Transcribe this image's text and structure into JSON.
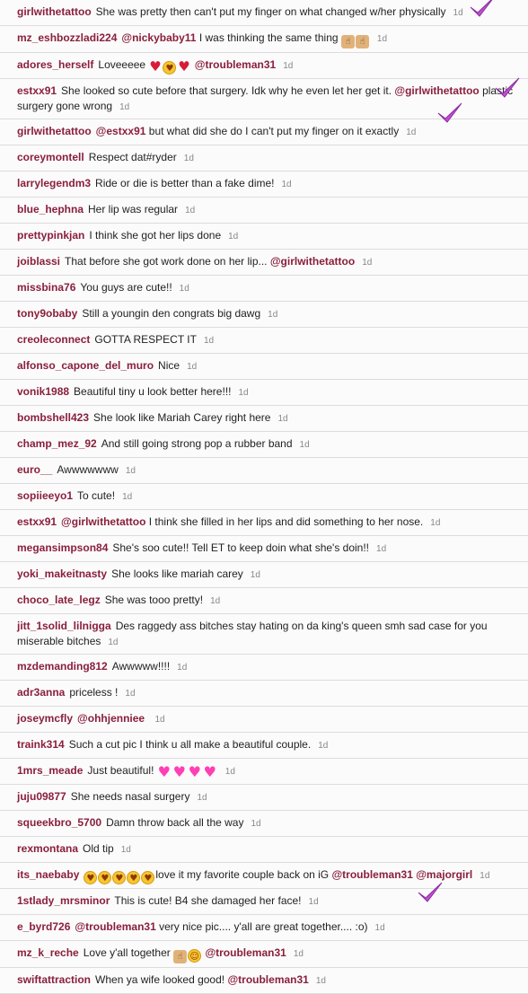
{
  "comments": [
    {
      "user": "girlwithetattoo",
      "text": "She was pretty then can't put my finger on what changed w/her physically",
      "time": "1d"
    },
    {
      "user": "mz_eshbozzladi224",
      "mention": "@nickybaby11",
      "text": "I was thinking the same thing",
      "emoji_after": [
        "thumbs-up",
        "thumbs-up"
      ],
      "time": "1d"
    },
    {
      "user": "adores_herself",
      "text": "Loveeeee",
      "emoji_after": [
        "heart",
        "heart-eyes",
        "heart"
      ],
      "mention_after": "@troubleman31",
      "time": "1d"
    },
    {
      "user": "estxx91",
      "text": "She looked so cute before that surgery. Idk why he even let her get it.",
      "mention_after": "@girlwithetattoo",
      "text_after": "plastic surgery gone wrong",
      "time": "1d"
    },
    {
      "user": "girlwithetattoo",
      "mention": "@estxx91",
      "text": "but what did she do I can't put my finger on it exactly",
      "time": "1d"
    },
    {
      "user": "coreymontell",
      "text": "Respect dat#ryder",
      "time": "1d"
    },
    {
      "user": "larrylegendm3",
      "text": "Ride or die is better than a fake dime!",
      "time": "1d"
    },
    {
      "user": "blue_hephna",
      "text": "Her lip was regular",
      "time": "1d"
    },
    {
      "user": "prettypinkjan",
      "text": "I think she got her lips done",
      "time": "1d"
    },
    {
      "user": "joiblassi",
      "text": "That before she got work done on her lip...",
      "mention_after": "@girlwithetattoo",
      "time": "1d"
    },
    {
      "user": "missbina76",
      "text": "You guys are cute!!",
      "time": "1d"
    },
    {
      "user": "tony9obaby",
      "text": "Still a youngin den congrats big dawg",
      "time": "1d"
    },
    {
      "user": "creoleconnect",
      "text": "GOTTA RESPECT IT",
      "time": "1d"
    },
    {
      "user": "alfonso_capone_del_muro",
      "text": "Nice",
      "time": "1d"
    },
    {
      "user": "vonik1988",
      "text": "Beautiful tiny u look better here!!!",
      "time": "1d"
    },
    {
      "user": "bombshell423",
      "text": "She look like Mariah Carey right here",
      "time": "1d"
    },
    {
      "user": "champ_mez_92",
      "text": "And still going strong pop a rubber band",
      "time": "1d"
    },
    {
      "user": "euro__",
      "text": "Awwwwwww",
      "time": "1d"
    },
    {
      "user": "sopiieeyo1",
      "text": "To cute!",
      "time": "1d"
    },
    {
      "user": "estxx91",
      "mention": "@girlwithetattoo",
      "text": "I think she filled in her lips and did something to her nose.",
      "time": "1d"
    },
    {
      "user": "megansimpson84",
      "text": "She's soo cute!! Tell ET to keep doin what she's doin!!",
      "time": "1d"
    },
    {
      "user": "yoki_makeitnasty",
      "text": "She looks like mariah carey",
      "time": "1d"
    },
    {
      "user": "choco_late_legz",
      "text": "She was tooo pretty!",
      "time": "1d"
    },
    {
      "user": "jitt_1solid_lilnigga",
      "text": "Des raggedy ass bitches stay hating on da king's queen smh sad case for you miserable bitches",
      "time": "1d"
    },
    {
      "user": "mzdemanding812",
      "text": "Awwwww!!!!",
      "time": "1d"
    },
    {
      "user": "adr3anna",
      "text": "priceless !",
      "time": "1d"
    },
    {
      "user": "joseymcfly",
      "mention": "@ohhjenniee",
      "text": "",
      "time": "1d"
    },
    {
      "user": "traink314",
      "text": "Such a cut pic I think u all make a beautiful couple.",
      "time": "1d"
    },
    {
      "user": "1mrs_meade",
      "text": "Just beautiful!",
      "emoji_after": [
        "pink-heart",
        "pink-heart",
        "pink-heart",
        "pink-heart"
      ],
      "time": "1d"
    },
    {
      "user": "juju09877",
      "text": "She needs nasal surgery",
      "time": "1d"
    },
    {
      "user": "squeekbro_5700",
      "text": "Damn throw back all the way",
      "time": "1d"
    },
    {
      "user": "rexmontana",
      "text": "Old tip",
      "time": "1d"
    },
    {
      "user": "its_naebaby",
      "emoji_before": [
        "kiss-face",
        "kiss-face",
        "kiss-face",
        "kiss-face",
        "kiss-face"
      ],
      "text": "love it my favorite couple back on iG",
      "mention_after": "@troubleman31 @majorgirl",
      "time": "1d"
    },
    {
      "user": "1stlady_mrsminor",
      "text": "This is cute! B4 she damaged her face!",
      "time": "1d"
    },
    {
      "user": "e_byrd726",
      "mention": "@troubleman31",
      "text": "very nice pic.... y'all are great together.... :o)",
      "time": "1d"
    },
    {
      "user": "mz_k_reche",
      "text": "Love y'all together",
      "mention_after": "@troubleman31",
      "emoji_after": [
        "thumbs-up",
        "smile-face"
      ],
      "time": "1d"
    },
    {
      "user": "swiftattraction",
      "text": "When ya wife looked good!",
      "mention_after": "@troubleman31",
      "time": "1d"
    }
  ],
  "marks": [
    {
      "name": "checkmark-icon-1"
    },
    {
      "name": "checkmark-icon-2"
    },
    {
      "name": "checkmark-icon-3"
    },
    {
      "name": "checkmark-icon-4"
    }
  ],
  "colors": {
    "username": "#8a1f3c",
    "checkmark": "#c04fd0"
  }
}
